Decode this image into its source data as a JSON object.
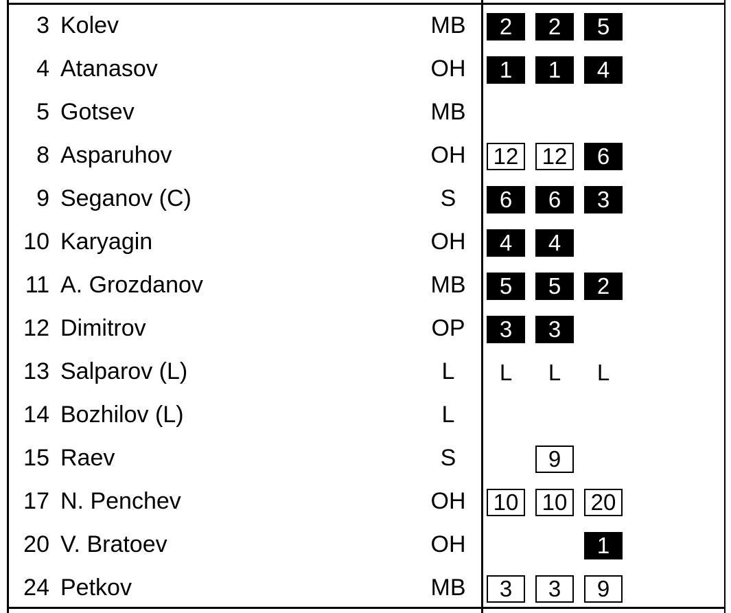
{
  "players": [
    {
      "number": "3",
      "name": "Kolev",
      "position": "MB",
      "sets": [
        {
          "value": "2",
          "style": "solid"
        },
        {
          "value": "2",
          "style": "solid"
        },
        {
          "value": "5",
          "style": "solid"
        }
      ]
    },
    {
      "number": "4",
      "name": "Atanasov",
      "position": "OH",
      "sets": [
        {
          "value": "1",
          "style": "solid"
        },
        {
          "value": "1",
          "style": "solid"
        },
        {
          "value": "4",
          "style": "solid"
        }
      ]
    },
    {
      "number": "5",
      "name": "Gotsev",
      "position": "MB",
      "sets": [
        {
          "value": "",
          "style": "empty"
        },
        {
          "value": "",
          "style": "empty"
        },
        {
          "value": "",
          "style": "empty"
        }
      ]
    },
    {
      "number": "8",
      "name": "Asparuhov",
      "position": "OH",
      "sets": [
        {
          "value": "12",
          "style": "outline"
        },
        {
          "value": "12",
          "style": "outline"
        },
        {
          "value": "6",
          "style": "solid"
        }
      ]
    },
    {
      "number": "9",
      "name": "Seganov (C)",
      "position": "S",
      "sets": [
        {
          "value": "6",
          "style": "solid"
        },
        {
          "value": "6",
          "style": "solid"
        },
        {
          "value": "3",
          "style": "solid"
        }
      ]
    },
    {
      "number": "10",
      "name": "Karyagin",
      "position": "OH",
      "sets": [
        {
          "value": "4",
          "style": "solid"
        },
        {
          "value": "4",
          "style": "solid"
        },
        {
          "value": "",
          "style": "empty"
        }
      ]
    },
    {
      "number": "11",
      "name": "A. Grozdanov",
      "position": "MB",
      "sets": [
        {
          "value": "5",
          "style": "solid"
        },
        {
          "value": "5",
          "style": "solid"
        },
        {
          "value": "2",
          "style": "solid"
        }
      ]
    },
    {
      "number": "12",
      "name": "Dimitrov",
      "position": "OP",
      "sets": [
        {
          "value": "3",
          "style": "solid"
        },
        {
          "value": "3",
          "style": "solid"
        },
        {
          "value": "",
          "style": "empty"
        }
      ]
    },
    {
      "number": "13",
      "name": "Salparov (L)",
      "position": "L",
      "sets": [
        {
          "value": "L",
          "style": "plain"
        },
        {
          "value": "L",
          "style": "plain"
        },
        {
          "value": "L",
          "style": "plain"
        }
      ]
    },
    {
      "number": "14",
      "name": "Bozhilov (L)",
      "position": "L",
      "sets": [
        {
          "value": "",
          "style": "empty"
        },
        {
          "value": "",
          "style": "empty"
        },
        {
          "value": "",
          "style": "empty"
        }
      ]
    },
    {
      "number": "15",
      "name": "Raev",
      "position": "S",
      "sets": [
        {
          "value": "",
          "style": "empty"
        },
        {
          "value": "9",
          "style": "outline"
        },
        {
          "value": "",
          "style": "empty"
        }
      ]
    },
    {
      "number": "17",
      "name": "N. Penchev",
      "position": "OH",
      "sets": [
        {
          "value": "10",
          "style": "outline"
        },
        {
          "value": "10",
          "style": "outline"
        },
        {
          "value": "20",
          "style": "outline"
        }
      ]
    },
    {
      "number": "20",
      "name": "V. Bratoev",
      "position": "OH",
      "sets": [
        {
          "value": "",
          "style": "empty"
        },
        {
          "value": "",
          "style": "empty"
        },
        {
          "value": "1",
          "style": "solid"
        }
      ]
    },
    {
      "number": "24",
      "name": "Petkov",
      "position": "MB",
      "sets": [
        {
          "value": "3",
          "style": "outline"
        },
        {
          "value": "3",
          "style": "outline"
        },
        {
          "value": "9",
          "style": "outline"
        }
      ]
    }
  ]
}
